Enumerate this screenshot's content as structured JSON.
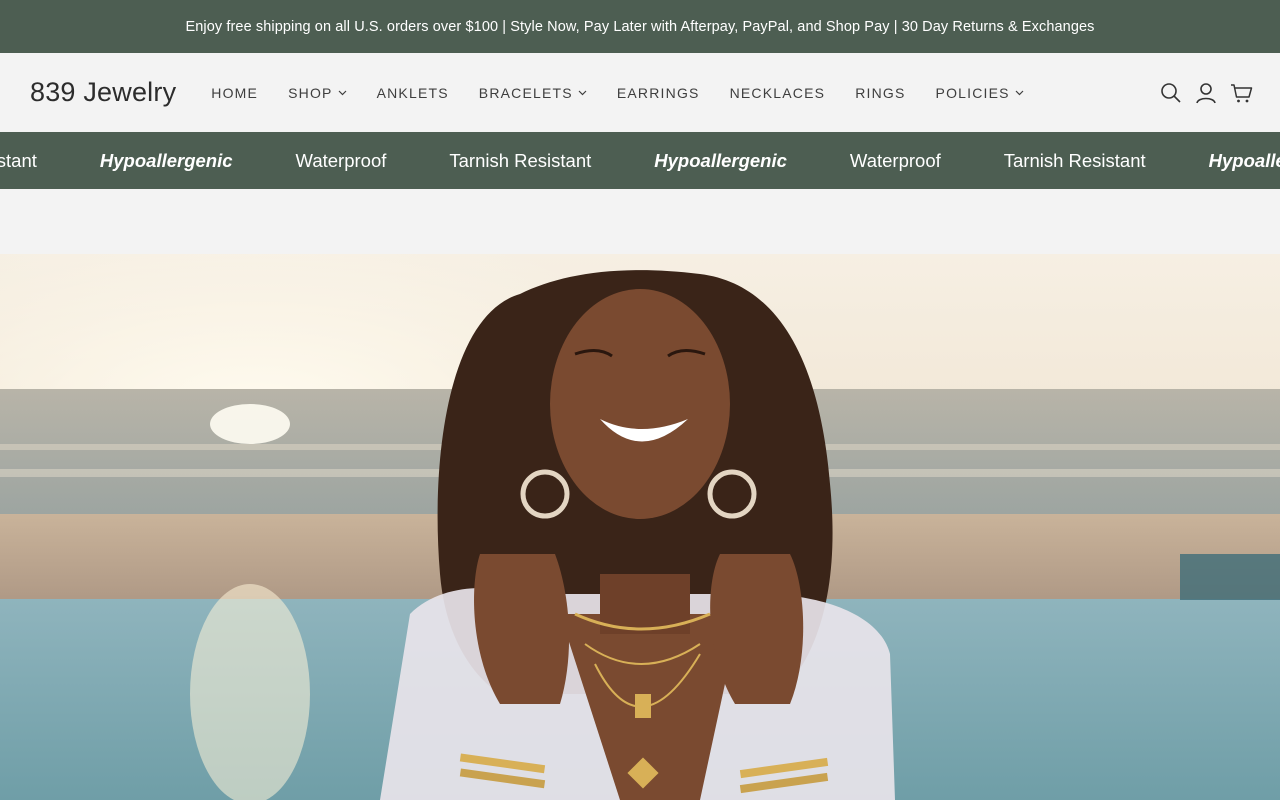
{
  "announcement": {
    "text": "Enjoy free shipping on all U.S. orders over $100 | Style Now, Pay Later with Afterpay, PayPal, and Shop Pay | 30 Day Returns & Exchanges"
  },
  "header": {
    "logo": "839 Jewelry",
    "nav": [
      {
        "label": "HOME",
        "has_dropdown": false
      },
      {
        "label": "SHOP",
        "has_dropdown": true
      },
      {
        "label": "ANKLETS",
        "has_dropdown": false
      },
      {
        "label": "BRACELETS",
        "has_dropdown": true
      },
      {
        "label": "EARRINGS",
        "has_dropdown": false
      },
      {
        "label": "NECKLACES",
        "has_dropdown": false
      },
      {
        "label": "RINGS",
        "has_dropdown": false
      },
      {
        "label": "POLICIES",
        "has_dropdown": true
      }
    ],
    "icons": [
      "search-icon",
      "account-icon",
      "cart-icon"
    ]
  },
  "marquee": {
    "items": [
      {
        "label": "Tarnish Resistant",
        "style": "normal"
      },
      {
        "label": "Hypoallergenic",
        "style": "italic"
      },
      {
        "label": "Waterproof",
        "style": "normal"
      },
      {
        "label": "Tarnish Resistant",
        "style": "normal"
      },
      {
        "label": "Hypoallergenic",
        "style": "italic"
      },
      {
        "label": "Waterproof",
        "style": "normal"
      },
      {
        "label": "Tarnish Resistant",
        "style": "normal"
      },
      {
        "label": "Hypoallergenic",
        "style": "italic"
      }
    ]
  },
  "colors": {
    "brand_green": "#4d5e52",
    "background": "#f3f3f3",
    "text_dark": "#2c2c2c"
  },
  "hero": {
    "image_description_icon": "hero-photo"
  }
}
